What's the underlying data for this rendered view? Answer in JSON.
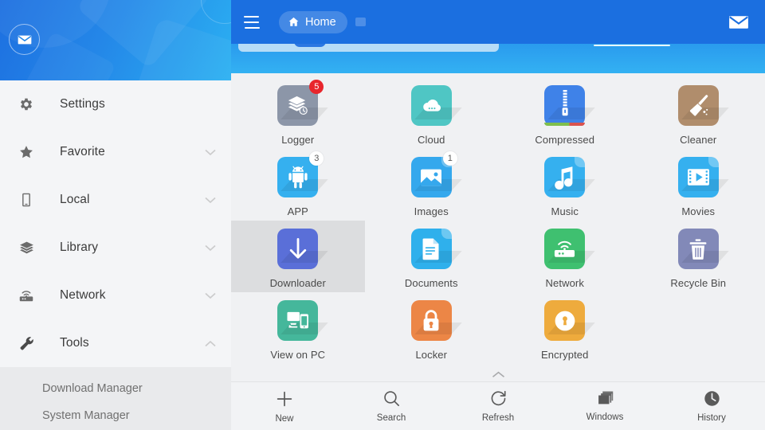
{
  "sidebar": {
    "avatar_icon": "envelope-icon",
    "items": [
      {
        "label": "Settings",
        "icon": "gear-icon",
        "chevron": "none"
      },
      {
        "label": "Favorite",
        "icon": "star-icon",
        "chevron": "down"
      },
      {
        "label": "Local",
        "icon": "phone-icon",
        "chevron": "down"
      },
      {
        "label": "Library",
        "icon": "layers-icon",
        "chevron": "down"
      },
      {
        "label": "Network",
        "icon": "router-icon",
        "chevron": "down"
      },
      {
        "label": "Tools",
        "icon": "wrench-icon",
        "chevron": "up"
      }
    ],
    "submenu": [
      {
        "label": "Download Manager"
      },
      {
        "label": "System Manager"
      }
    ]
  },
  "topbar": {
    "menu_icon": "hamburger-icon",
    "home_label": "Home",
    "home_icon": "house-icon",
    "tab_badge_icon": "tab-icon",
    "mail_icon": "envelope-icon",
    "background_color": "#1b6fe0"
  },
  "grid": {
    "items": [
      {
        "label": "Logger",
        "icon": "layers-clock-icon",
        "color": "#8c96a8",
        "badge": "5",
        "badge_style": "red",
        "fold": false,
        "selected": false
      },
      {
        "label": "Cloud",
        "icon": "cloud-icon",
        "color": "#4fc6c4",
        "badge": "",
        "badge_style": "",
        "fold": false,
        "selected": false
      },
      {
        "label": "Compressed",
        "icon": "zip-icon",
        "color": "#3f82e8",
        "badge": "",
        "badge_style": "",
        "fold": false,
        "selected": false
      },
      {
        "label": "Cleaner",
        "icon": "broom-icon",
        "color": "#b08d6c",
        "badge": "",
        "badge_style": "",
        "fold": false,
        "selected": false
      },
      {
        "label": "APP",
        "icon": "android-icon",
        "color": "#35b0ef",
        "badge": "3",
        "badge_style": "white",
        "fold": false,
        "selected": false
      },
      {
        "label": "Images",
        "icon": "photo-icon",
        "color": "#35a8ed",
        "badge": "1",
        "badge_style": "white",
        "fold": true,
        "selected": false
      },
      {
        "label": "Music",
        "icon": "note-icon",
        "color": "#35b0ef",
        "badge": "",
        "badge_style": "",
        "fold": true,
        "selected": false
      },
      {
        "label": "Movies",
        "icon": "film-icon",
        "color": "#35b0ef",
        "badge": "",
        "badge_style": "",
        "fold": true,
        "selected": false
      },
      {
        "label": "Downloader",
        "icon": "download-arrow-icon",
        "color": "#5a6fd8",
        "badge": "",
        "badge_style": "",
        "fold": false,
        "selected": true
      },
      {
        "label": "Documents",
        "icon": "document-icon",
        "color": "#2fb0ec",
        "badge": "",
        "badge_style": "",
        "fold": true,
        "selected": false
      },
      {
        "label": "Network",
        "icon": "router-icon",
        "color": "#3fc070",
        "badge": "",
        "badge_style": "",
        "fold": false,
        "selected": false
      },
      {
        "label": "Recycle Bin",
        "icon": "trash-icon",
        "color": "#8289b8",
        "badge": "",
        "badge_style": "",
        "fold": false,
        "selected": false
      },
      {
        "label": "View on PC",
        "icon": "pc-phone-icon",
        "color": "#45b79b",
        "badge": "",
        "badge_style": "",
        "fold": false,
        "selected": false
      },
      {
        "label": "Locker",
        "icon": "padlock-icon",
        "color": "#ec8646",
        "badge": "",
        "badge_style": "",
        "fold": false,
        "selected": false
      },
      {
        "label": "Encrypted",
        "icon": "keyhole-icon",
        "color": "#eeab3d",
        "badge": "",
        "badge_style": "",
        "fold": false,
        "selected": false
      }
    ]
  },
  "bottombar": {
    "collapse_icon": "chevron-up-icon",
    "items": [
      {
        "label": "New",
        "icon": "plus-icon"
      },
      {
        "label": "Search",
        "icon": "magnifier-icon"
      },
      {
        "label": "Refresh",
        "icon": "refresh-icon"
      },
      {
        "label": "Windows",
        "icon": "windows-stack-icon"
      },
      {
        "label": "History",
        "icon": "clock-icon"
      }
    ]
  }
}
